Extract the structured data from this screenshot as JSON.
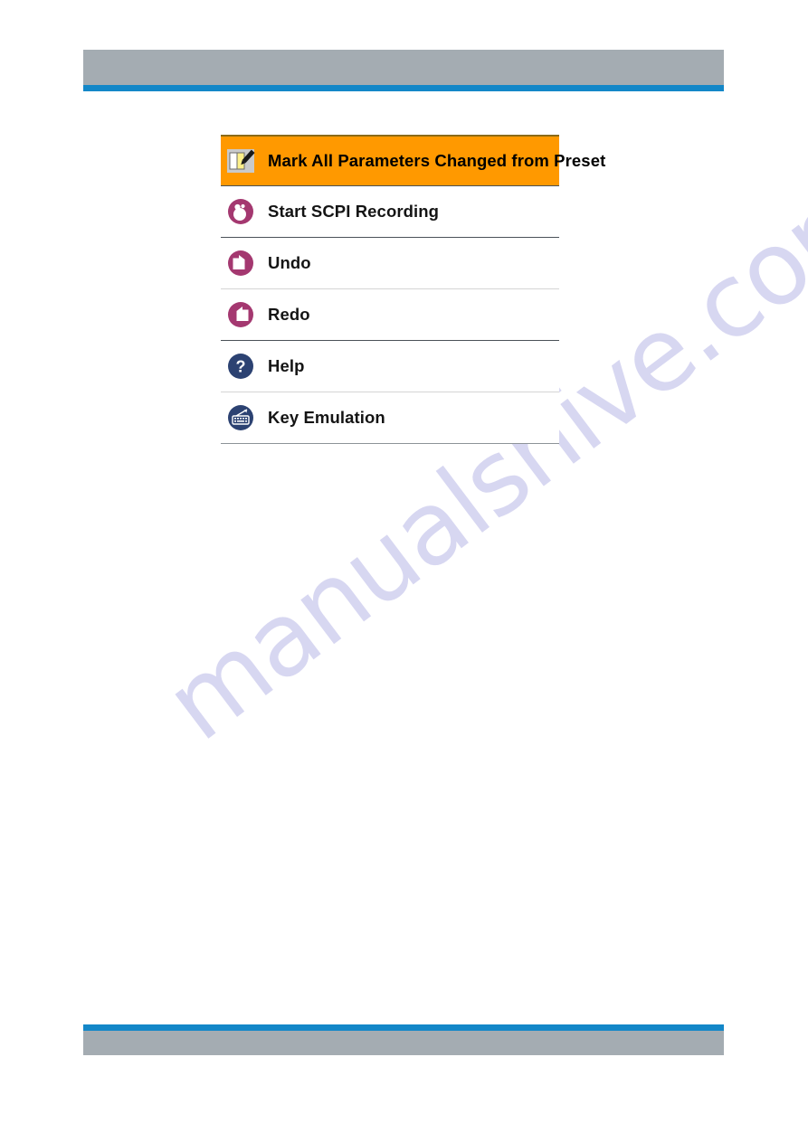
{
  "page": {
    "header_bar_color": "#a4acb2",
    "accent_rule_color": "#1387c8",
    "background_color": "#ffffff"
  },
  "watermark": {
    "text": "manualshive.com",
    "color": "#c9c8ec"
  },
  "menu": {
    "highlight_color": "#ff9900",
    "magenta_icon_color": "#a43870",
    "navy_icon_color": "#2c4272",
    "items": [
      {
        "label": "Mark All Parameters Changed from Preset",
        "icon": "note-pen-icon",
        "highlighted": true,
        "separator": "none"
      },
      {
        "label": "Start SCPI Recording",
        "icon": "record-icon",
        "highlighted": false,
        "separator": "strong"
      },
      {
        "label": "Undo",
        "icon": "undo-arrow-icon",
        "highlighted": false,
        "separator": "light"
      },
      {
        "label": "Redo",
        "icon": "redo-arrow-icon",
        "highlighted": false,
        "separator": "strong"
      },
      {
        "label": "Help",
        "icon": "question-mark-icon",
        "highlighted": false,
        "separator": "light"
      },
      {
        "label": "Key Emulation",
        "icon": "keyboard-icon",
        "highlighted": false,
        "separator": "bottom"
      }
    ]
  }
}
